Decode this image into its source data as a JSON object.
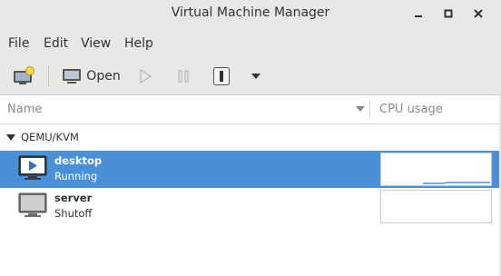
{
  "window": {
    "title": "Virtual Machine Manager",
    "controls": [
      "minimize-icon",
      "maximize-icon",
      "close-icon"
    ]
  },
  "menu": {
    "items": [
      "File",
      "Edit",
      "View",
      "Help"
    ]
  },
  "toolbar": {
    "new_vm_icon": "new-vm-icon",
    "open_label": "Open",
    "open_icon": "monitor-icon",
    "run_icon": "play-icon",
    "pause_icon": "pause-icon",
    "shutdown_icon": "power-icon",
    "shutdown_menu_icon": "dropdown-arrow-icon"
  },
  "list": {
    "columns": [
      "Name",
      "CPU usage"
    ],
    "groups": [
      {
        "name": "QEMU/KVM",
        "expanded": true,
        "vms": [
          {
            "name": "desktop",
            "status": "Running",
            "selected": true,
            "icon": "vm-running-icon"
          },
          {
            "name": "server",
            "status": "Shutoff",
            "selected": false,
            "icon": "vm-off-icon"
          }
        ]
      }
    ]
  },
  "colors": {
    "selection": "#4a90d9",
    "chrome": "#e8e8e7",
    "cpu_line": "#4a90d9"
  }
}
